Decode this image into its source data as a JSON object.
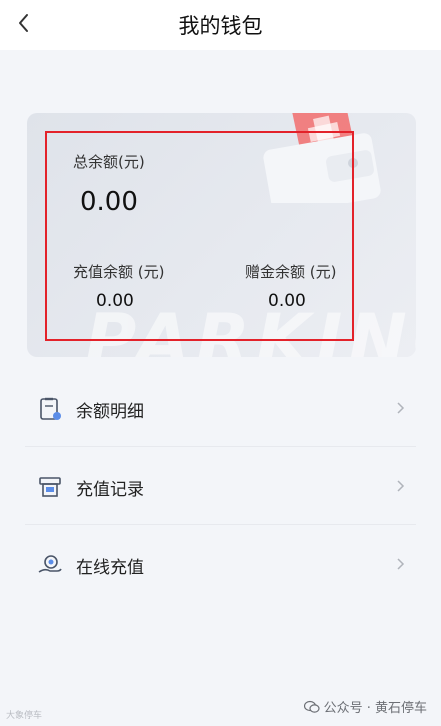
{
  "header": {
    "title": "我的钱包"
  },
  "wallet": {
    "total_label": "总余额(元)",
    "total_value": "0.00",
    "recharge_label": "充值余额 (元)",
    "recharge_value": "0.00",
    "gift_label": "赠金余额 (元)",
    "gift_value": "0.00",
    "card_watermark": "PARKING"
  },
  "menu": [
    {
      "label": "余额明细",
      "icon": "document-icon"
    },
    {
      "label": "充值记录",
      "icon": "receipt-icon"
    },
    {
      "label": "在线充值",
      "icon": "hand-coin-icon"
    }
  ],
  "footer": {
    "left_text": "大象停车",
    "right_text": "公众号 · 黄石停车"
  },
  "colors": {
    "highlight_border": "#e3222a",
    "background": "#f3f5f9",
    "card": "#e3e6ec"
  }
}
